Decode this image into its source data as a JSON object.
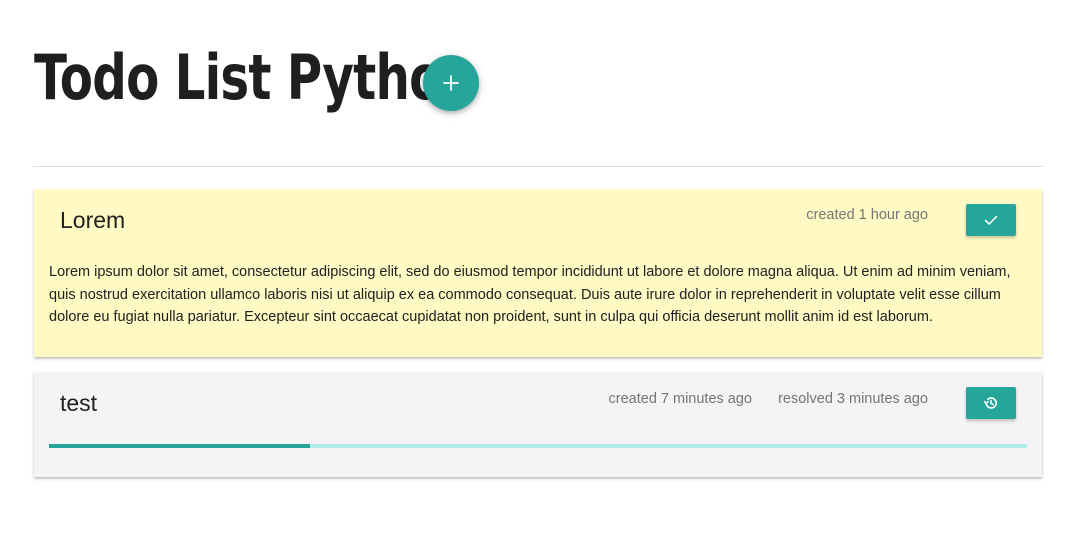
{
  "header": {
    "title": "Todo List Python",
    "add_icon": "plus-icon"
  },
  "colors": {
    "accent": "#26a69a",
    "track": "#b2ebe7",
    "card_active_bg": "#fff9c4",
    "card_resolved_bg": "#f4f4f4"
  },
  "todos": [
    {
      "title": "Lorem",
      "created": "created 1 hour ago",
      "body": "Lorem ipsum dolor sit amet, consectetur adipiscing elit, sed do eiusmod tempor incididunt ut labore et dolore magna aliqua. Ut enim ad minim veniam, quis nostrud exercitation ullamco laboris nisi ut aliquip ex ea commodo consequat. Duis aute irure dolor in reprehenderit in voluptate velit esse cillum dolore eu fugiat nulla pariatur. Excepteur sint occaecat cupidatat non proident, sunt in culpa qui officia deserunt mollit anim id est laborum.",
      "action_icon": "check-icon"
    },
    {
      "title": "test",
      "created": "created 7 minutes ago",
      "resolved": "resolved 3 minutes ago",
      "action_icon": "restore-icon",
      "progress": 0.267
    }
  ]
}
